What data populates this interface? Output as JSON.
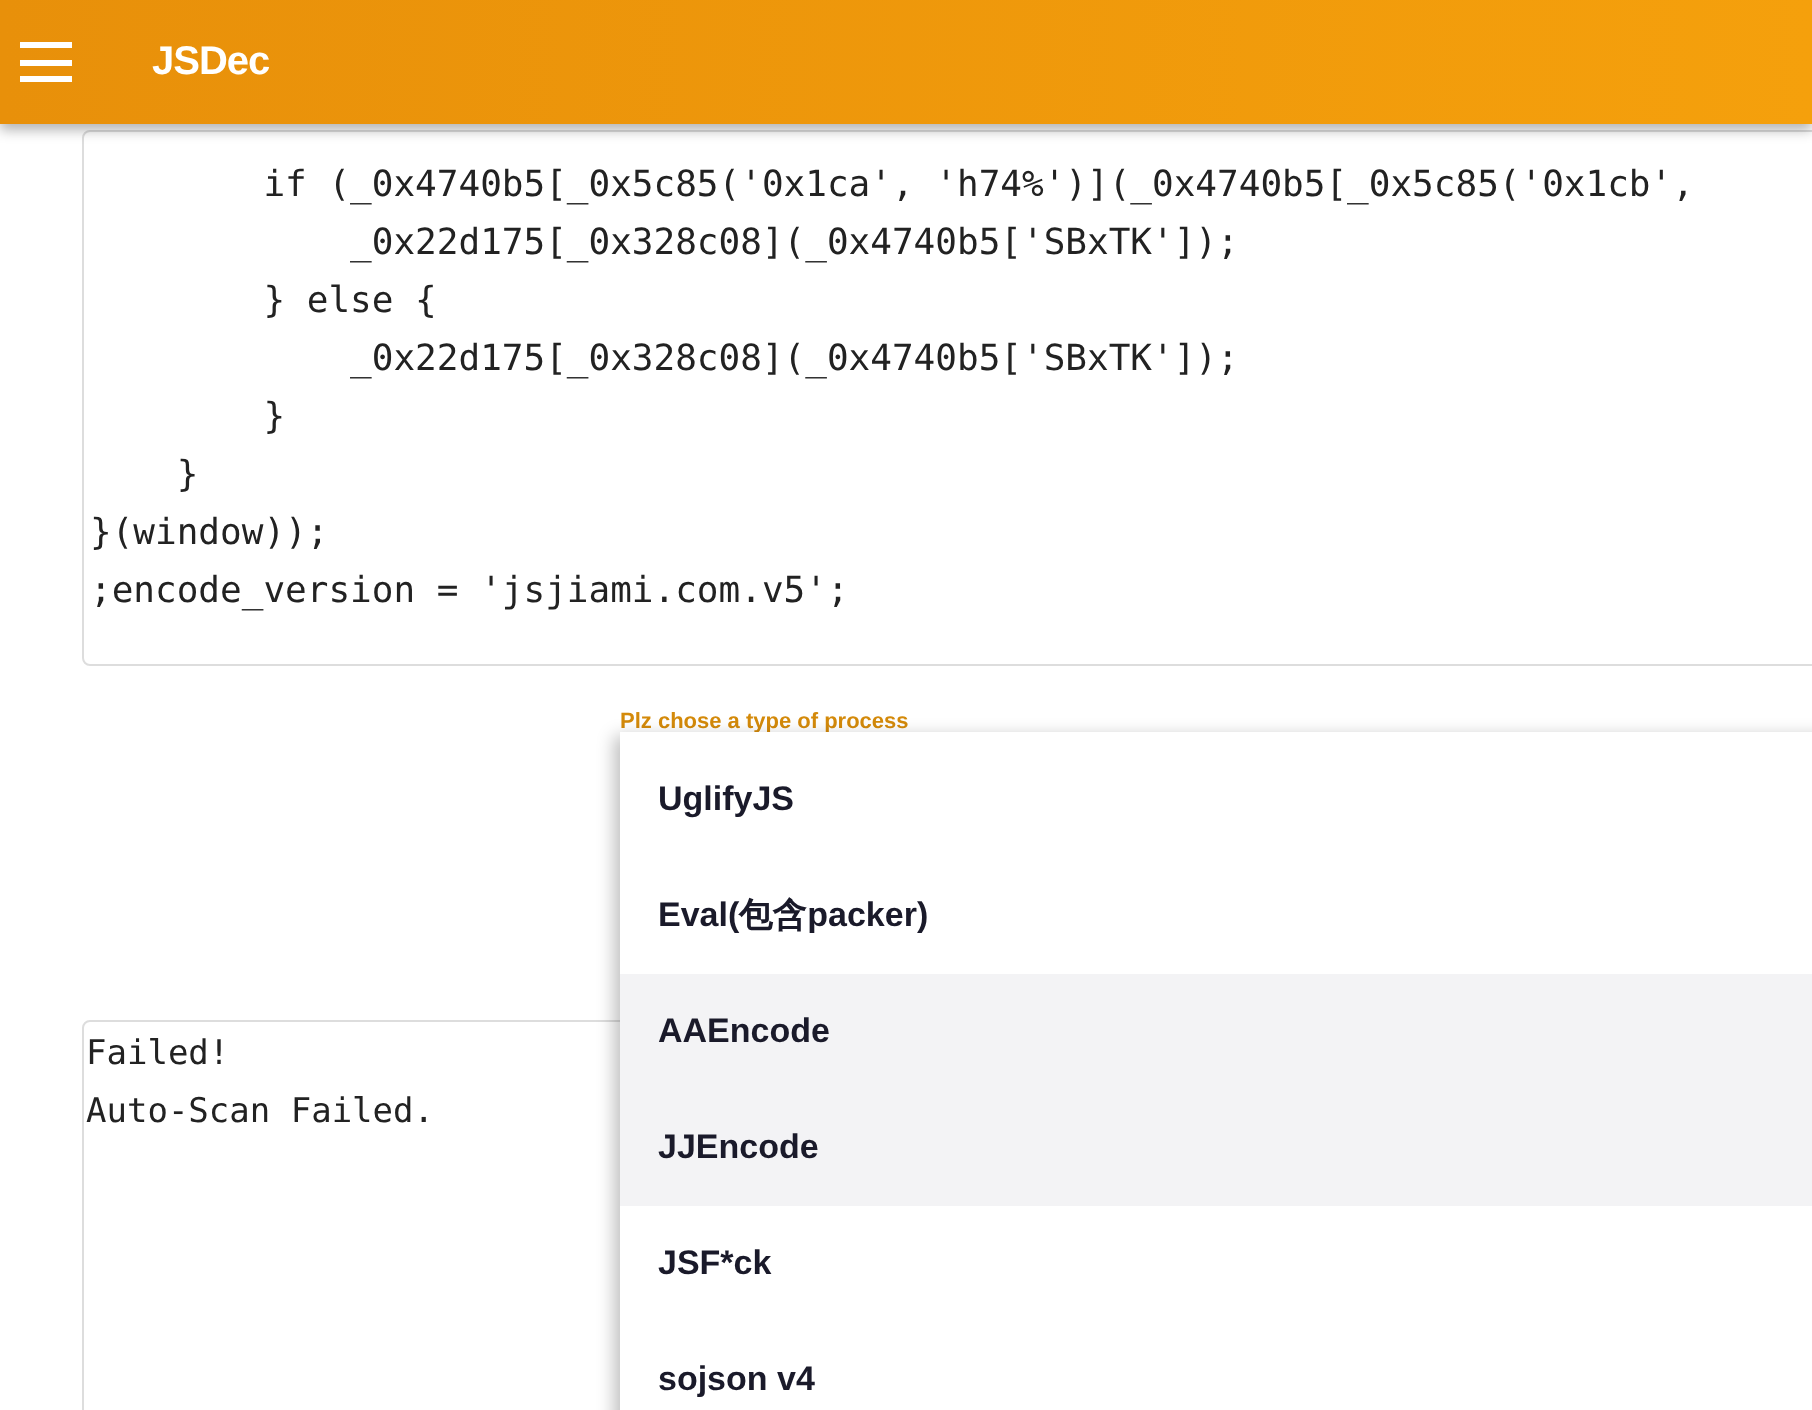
{
  "app_bar": {
    "title": "JSDec"
  },
  "code_lines": [
    "        if (_0x4740b5[_0x5c85('0x1ca', 'h74%')](_0x4740b5[_0x5c85('0x1cb',",
    "            _0x22d175[_0x328c08](_0x4740b5['SBxTK']);",
    "        } else {",
    "            _0x22d175[_0x328c08](_0x4740b5['SBxTK']);",
    "        }",
    "    }",
    "}(window));",
    ";encode_version = 'jsjiami.com.v5';"
  ],
  "process_select": {
    "label": "Plz chose a type of process",
    "options": [
      {
        "label": "UglifyJS",
        "highlighted": false
      },
      {
        "label": "Eval(包含packer)",
        "highlighted": false
      },
      {
        "label": "AAEncode",
        "highlighted": true
      },
      {
        "label": "JJEncode",
        "highlighted": true
      },
      {
        "label": "JSF*ck",
        "highlighted": false
      },
      {
        "label": "sojson v4",
        "highlighted": false
      }
    ]
  },
  "output_lines": [
    "Failed!",
    "Auto-Scan Failed."
  ]
}
